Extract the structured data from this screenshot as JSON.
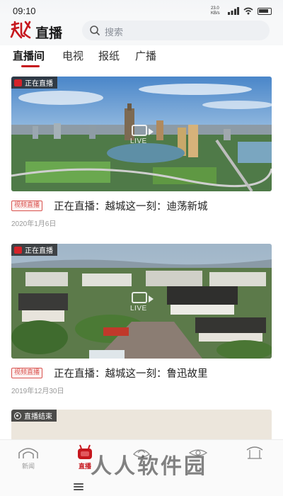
{
  "status": {
    "time": "09:10",
    "net": "23.0 KB/s"
  },
  "header": {
    "title": "直播",
    "logo_text": "越"
  },
  "search": {
    "placeholder": "搜索"
  },
  "tabs": [
    {
      "label": "直播间"
    },
    {
      "label": "电视"
    },
    {
      "label": "报纸"
    },
    {
      "label": "广播"
    }
  ],
  "cards": [
    {
      "badge": "正在直播",
      "tag": "视频直播",
      "title": "正在直播：越城这一刻：迪荡新城",
      "date": "2020年1月6日",
      "live": "LIVE"
    },
    {
      "badge": "正在直播",
      "tag": "视频直播",
      "title": "正在直播：越城这一刻：鲁迅故里",
      "date": "2019年12月30日",
      "live": "LIVE"
    },
    {
      "badge": "直播结束"
    }
  ],
  "bottom_nav": [
    {
      "label": "新闻"
    },
    {
      "label": "直播"
    },
    {
      "label": ""
    },
    {
      "label": ""
    },
    {
      "label": ""
    }
  ],
  "watermark": "人人软件园",
  "colors": {
    "accent": "#c6171e",
    "tag_red": "#d9534f"
  }
}
